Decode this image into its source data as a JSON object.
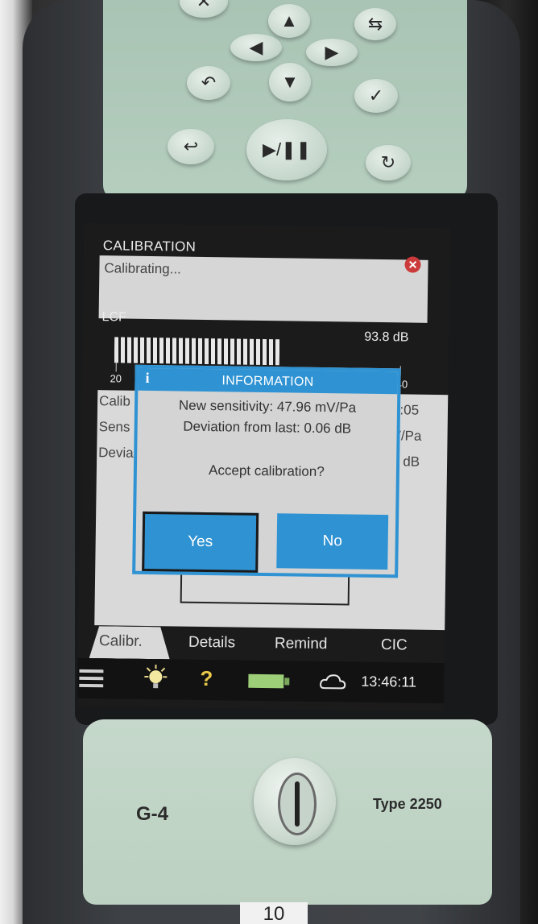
{
  "screen": {
    "title": "CALIBRATION",
    "status_text": "Calibrating...",
    "weighting": "LCF",
    "level": "93.8 dB",
    "scale": {
      "min": "20",
      "max": "140"
    },
    "level_fraction": 0.58,
    "panel": {
      "row1_left": "Calib",
      "row1_right": "3:05",
      "row2_left": "Sens",
      "row2_right": "V/Pa",
      "row3_left": "Devia",
      "row3_right": "2 dB"
    },
    "dialog": {
      "icon": "i",
      "title": "INFORMATION",
      "line1": "New sensitivity: 47.96 mV/Pa",
      "line2": "Deviation from last: 0.06 dB",
      "question": "Accept calibration?",
      "yes_label": "Yes",
      "no_label": "No"
    },
    "tabs": [
      {
        "label": "Calibr."
      },
      {
        "label": "Details"
      },
      {
        "label": "Remind"
      },
      {
        "label": "CIC"
      }
    ],
    "status_bar": {
      "help_label": "?",
      "time": "13:46:11"
    }
  },
  "device": {
    "brand_left": "G-4",
    "model": "Type 2250",
    "tag_label": "10"
  },
  "colors": {
    "accent_blue": "#2f93d3",
    "screen_bg": "#1b1b1b",
    "panel_bg": "#d9d9d9",
    "keypad_green": "#b6cfbf",
    "close_red": "#cc3b3b"
  },
  "icons": [
    "menu-icon",
    "backlight-icon",
    "help-icon",
    "battery-icon",
    "cloud-icon",
    "close-icon",
    "info-icon"
  ]
}
